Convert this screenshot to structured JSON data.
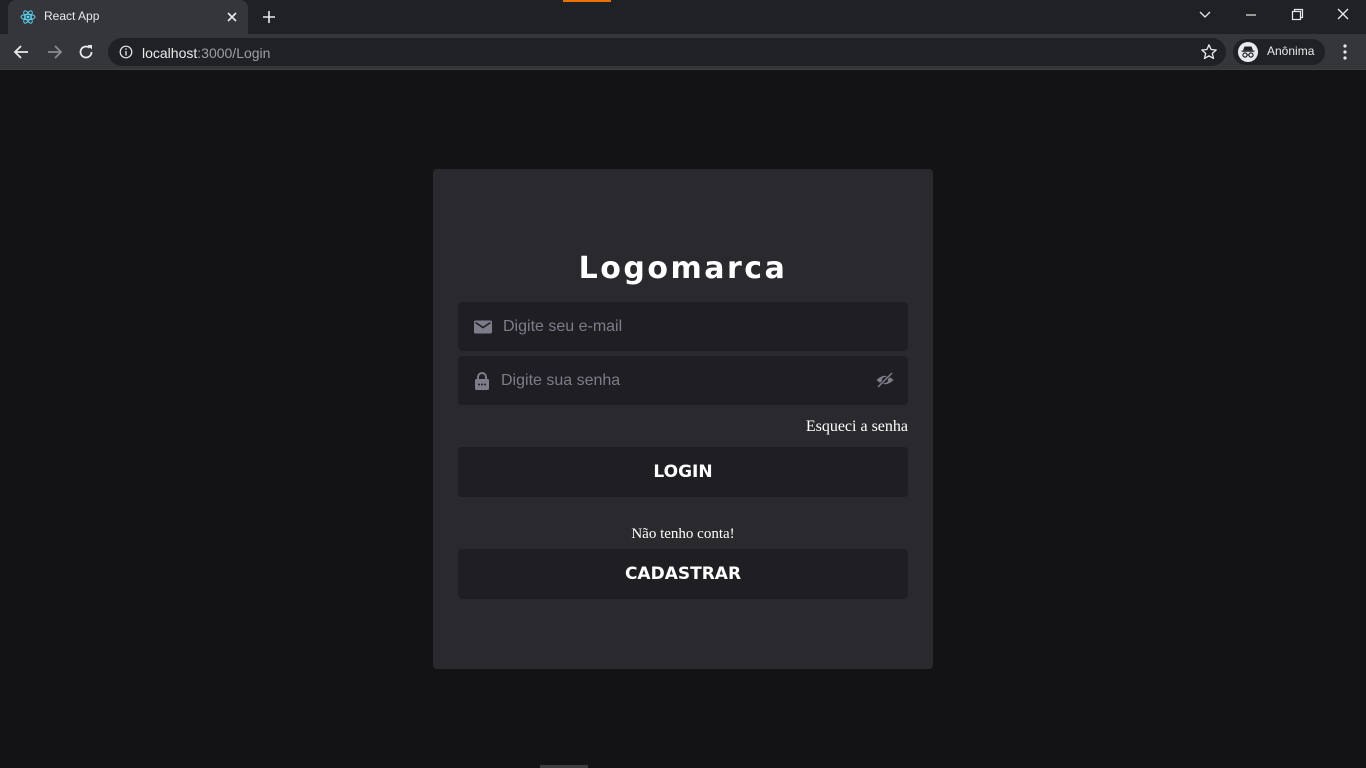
{
  "browser": {
    "tab_title": "React App",
    "url_host": "localhost",
    "url_rest": ":3000/Login",
    "profile_label": "Anônima",
    "accent_color": "#e8710a"
  },
  "login": {
    "logo": "Logomarca",
    "email_placeholder": "Digite seu e-mail",
    "password_placeholder": "Digite sua senha",
    "forgot_password": "Esqueci a senha",
    "login_button": "LOGIN",
    "no_account": "Não tenho conta!",
    "register_button": "CADASTRAR"
  },
  "colors": {
    "page_background": "#131316",
    "card_background": "#29292e",
    "input_background": "#1f1f23",
    "placeholder": "#7c7c8a",
    "text": "#ffffff"
  }
}
